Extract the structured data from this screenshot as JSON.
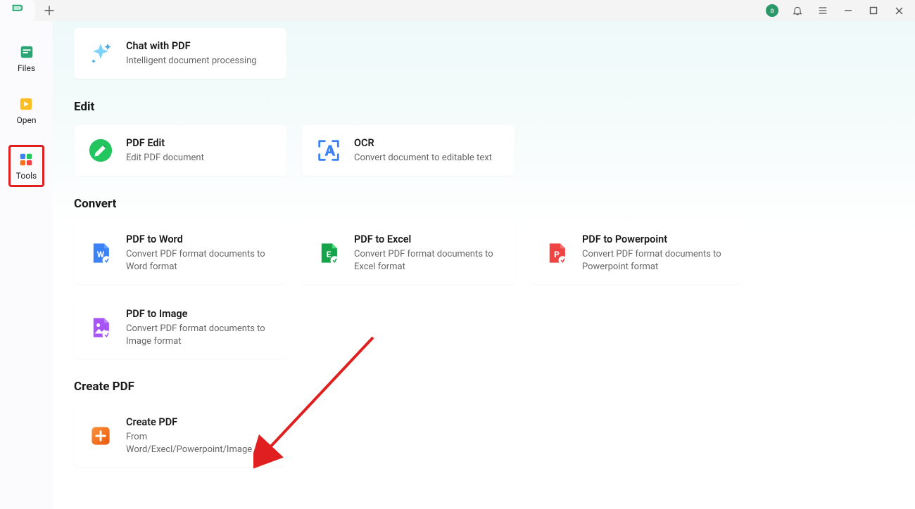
{
  "titlebar": {
    "avatar_letter": "a"
  },
  "sidebar": {
    "items": [
      {
        "label": "Files"
      },
      {
        "label": "Open"
      },
      {
        "label": "Tools"
      }
    ]
  },
  "chat_card": {
    "title": "Chat with PDF",
    "sub": "Intelligent document processing"
  },
  "sections": {
    "edit": {
      "title": "Edit",
      "cards": [
        {
          "title": "PDF Edit",
          "sub": "Edit PDF document"
        },
        {
          "title": "OCR",
          "sub": "Convert document to editable text"
        }
      ]
    },
    "convert": {
      "title": "Convert",
      "cards": [
        {
          "title": "PDF to Word",
          "sub": "Convert PDF format documents to Word format"
        },
        {
          "title": "PDF to Excel",
          "sub": "Convert PDF format documents to Excel format"
        },
        {
          "title": "PDF to Powerpoint",
          "sub": "Convert PDF format documents to Powerpoint format"
        },
        {
          "title": "PDF to Image",
          "sub": "Convert PDF format documents to Image format"
        }
      ]
    },
    "create": {
      "title": "Create PDF",
      "cards": [
        {
          "title": "Create PDF",
          "sub": "From Word/Execl/Powerpoint/Image"
        }
      ]
    }
  }
}
